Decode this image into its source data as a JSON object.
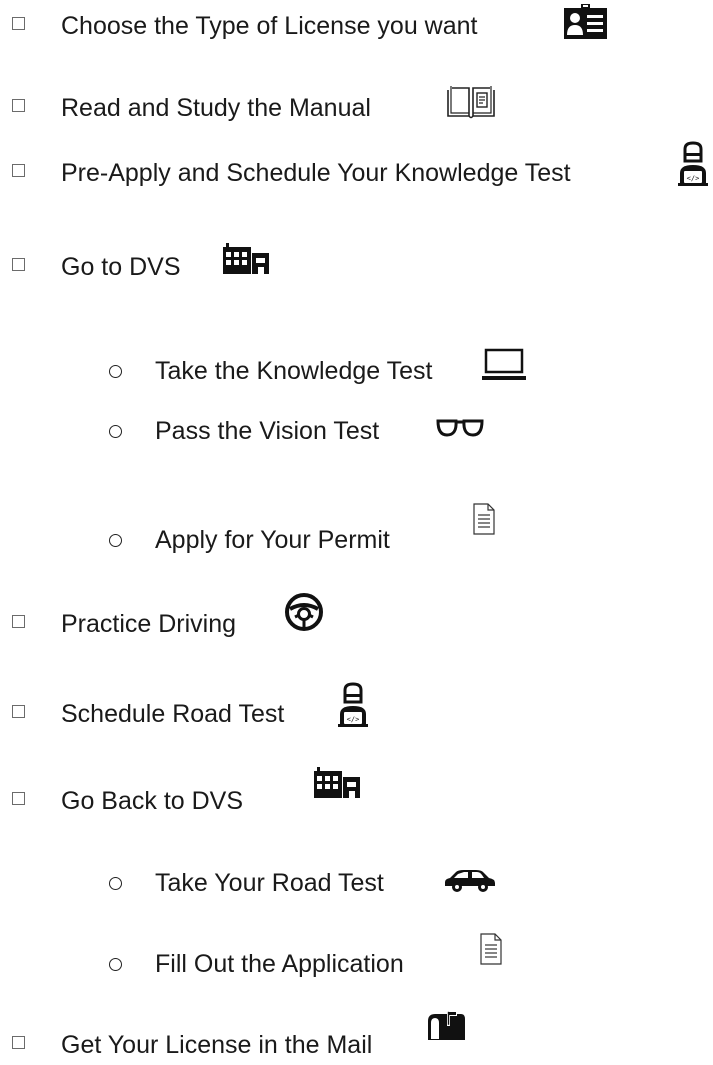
{
  "checklist": {
    "items": [
      {
        "label": "Choose the Type of License you want",
        "icon": "id-card-icon"
      },
      {
        "label": "Read and Study the Manual",
        "icon": "open-book-icon"
      },
      {
        "label": "Pre-Apply and Schedule Your Knowledge Test",
        "icon": "person-laptop-icon"
      },
      {
        "label": "Go to DVS",
        "icon": "building-icon",
        "subitems": [
          {
            "label": "Take the Knowledge Test",
            "icon": "laptop-icon"
          },
          {
            "label": "Pass the Vision Test",
            "icon": "glasses-icon"
          },
          {
            "label": "Apply for Your Permit",
            "icon": "document-icon"
          }
        ]
      },
      {
        "label": "Practice Driving",
        "icon": "steering-wheel-icon"
      },
      {
        "label": "Schedule Road Test",
        "icon": "person-laptop-icon"
      },
      {
        "label": "Go Back to DVS",
        "icon": "building-icon",
        "subitems": [
          {
            "label": "Take Your Road Test",
            "icon": "car-icon"
          },
          {
            "label": "Fill Out the Application",
            "icon": "document-icon"
          }
        ]
      },
      {
        "label": "Get Your License in the Mail",
        "icon": "mailbox-icon"
      }
    ]
  }
}
